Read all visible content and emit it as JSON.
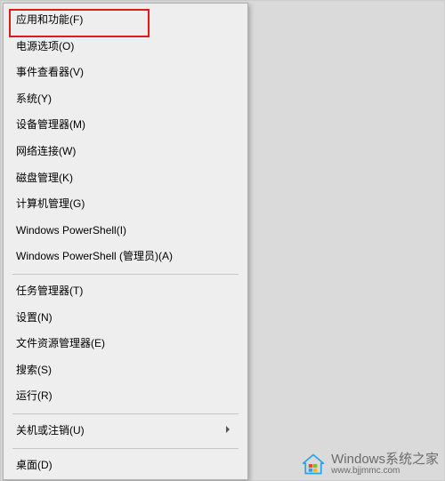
{
  "menu": {
    "groups": [
      [
        {
          "label": "应用和功能(F)",
          "name": "menu-apps-features",
          "highlighted": true
        },
        {
          "label": "电源选项(O)",
          "name": "menu-power-options"
        },
        {
          "label": "事件查看器(V)",
          "name": "menu-event-viewer"
        },
        {
          "label": "系统(Y)",
          "name": "menu-system"
        },
        {
          "label": "设备管理器(M)",
          "name": "menu-device-manager"
        },
        {
          "label": "网络连接(W)",
          "name": "menu-network-connections"
        },
        {
          "label": "磁盘管理(K)",
          "name": "menu-disk-management"
        },
        {
          "label": "计算机管理(G)",
          "name": "menu-computer-management"
        },
        {
          "label": "Windows PowerShell(I)",
          "name": "menu-powershell"
        },
        {
          "label": "Windows PowerShell (管理员)(A)",
          "name": "menu-powershell-admin"
        }
      ],
      [
        {
          "label": "任务管理器(T)",
          "name": "menu-task-manager"
        },
        {
          "label": "设置(N)",
          "name": "menu-settings"
        },
        {
          "label": "文件资源管理器(E)",
          "name": "menu-file-explorer"
        },
        {
          "label": "搜索(S)",
          "name": "menu-search"
        },
        {
          "label": "运行(R)",
          "name": "menu-run"
        }
      ],
      [
        {
          "label": "关机或注销(U)",
          "name": "menu-shutdown-signout",
          "submenu": true
        }
      ],
      [
        {
          "label": "桌面(D)",
          "name": "menu-desktop"
        }
      ]
    ]
  },
  "watermark": {
    "brand": "Windows系统之家",
    "site": "www.bjjmmc.com"
  }
}
